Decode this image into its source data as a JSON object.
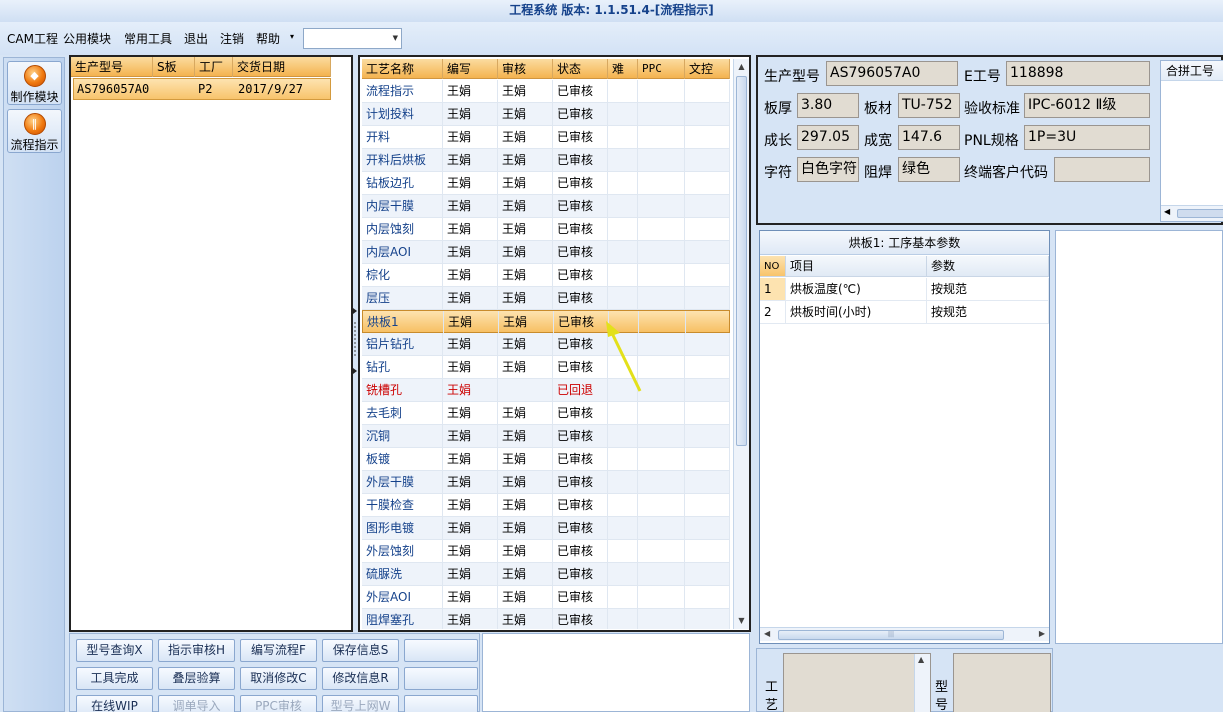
{
  "window": {
    "title": "工程系统 版本: 1.1.51.4-[流程指示]"
  },
  "menu": {
    "items": [
      "CAM工程",
      "公用模块",
      "常用工具",
      "退出",
      "注销",
      "帮助"
    ],
    "dropdown_arrow": "▾",
    "dropdown_value": ""
  },
  "toolbar": {
    "items": [
      {
        "label": "制作模块",
        "icon": "flame-icon"
      },
      {
        "label": "流程指示",
        "icon": "pause-bars-icon"
      }
    ]
  },
  "orders": {
    "columns": [
      "生产型号",
      "S板",
      "工厂",
      "交货日期"
    ],
    "rows": [
      {
        "model": "AS796057A0",
        "s_board": "",
        "factory": "P2",
        "due_date": "2017/9/27"
      }
    ]
  },
  "process": {
    "columns": [
      "工艺名称",
      "编写",
      "审核",
      "状态",
      "难",
      "PPC",
      "文控"
    ],
    "rows": [
      {
        "name": "流程指示",
        "writer": "王娟",
        "reviewer": "王娟",
        "status": "已审核"
      },
      {
        "name": "计划投料",
        "writer": "王娟",
        "reviewer": "王娟",
        "status": "已审核"
      },
      {
        "name": "开料",
        "writer": "王娟",
        "reviewer": "王娟",
        "status": "已审核"
      },
      {
        "name": "开料后烘板",
        "writer": "王娟",
        "reviewer": "王娟",
        "status": "已审核"
      },
      {
        "name": "钻板边孔",
        "writer": "王娟",
        "reviewer": "王娟",
        "status": "已审核"
      },
      {
        "name": "内层干膜",
        "writer": "王娟",
        "reviewer": "王娟",
        "status": "已审核"
      },
      {
        "name": "内层蚀刻",
        "writer": "王娟",
        "reviewer": "王娟",
        "status": "已审核"
      },
      {
        "name": "内层AOI",
        "writer": "王娟",
        "reviewer": "王娟",
        "status": "已审核"
      },
      {
        "name": "棕化",
        "writer": "王娟",
        "reviewer": "王娟",
        "status": "已审核"
      },
      {
        "name": "层压",
        "writer": "王娟",
        "reviewer": "王娟",
        "status": "已审核"
      },
      {
        "name": "烘板1",
        "writer": "王娟",
        "reviewer": "王娟",
        "status": "已审核",
        "selected": true
      },
      {
        "name": "铝片钻孔",
        "writer": "王娟",
        "reviewer": "王娟",
        "status": "已审核"
      },
      {
        "name": "钻孔",
        "writer": "王娟",
        "reviewer": "王娟",
        "status": "已审核"
      },
      {
        "name": "铣槽孔",
        "writer": "王娟",
        "reviewer": "",
        "status": "已回退",
        "returned": true
      },
      {
        "name": "去毛刺",
        "writer": "王娟",
        "reviewer": "王娟",
        "status": "已审核"
      },
      {
        "name": "沉铜",
        "writer": "王娟",
        "reviewer": "王娟",
        "status": "已审核"
      },
      {
        "name": "板镀",
        "writer": "王娟",
        "reviewer": "王娟",
        "status": "已审核"
      },
      {
        "name": "外层干膜",
        "writer": "王娟",
        "reviewer": "王娟",
        "status": "已审核"
      },
      {
        "name": "干膜检查",
        "writer": "王娟",
        "reviewer": "王娟",
        "status": "已审核"
      },
      {
        "name": "图形电镀",
        "writer": "王娟",
        "reviewer": "王娟",
        "status": "已审核"
      },
      {
        "name": "外层蚀刻",
        "writer": "王娟",
        "reviewer": "王娟",
        "status": "已审核"
      },
      {
        "name": "硫脲洗",
        "writer": "王娟",
        "reviewer": "王娟",
        "status": "已审核"
      },
      {
        "name": "外层AOI",
        "writer": "王娟",
        "reviewer": "王娟",
        "status": "已审核"
      },
      {
        "name": "阻焊塞孔",
        "writer": "王娟",
        "reviewer": "王娟",
        "status": "已审核"
      }
    ]
  },
  "info": {
    "model_label": "生产型号",
    "model": "AS796057A0",
    "eno_label": "E工号",
    "eno": "118898",
    "thickness_label": "板厚",
    "thickness": "3.80",
    "material_label": "板材",
    "material": "TU-752",
    "standard_label": "验收标准",
    "standard": "IPC-6012 Ⅱ级",
    "length_label": "成长",
    "length": "297.05",
    "width_label": "成宽",
    "width": "147.6",
    "pnl_label": "PNL规格",
    "pnl": "1P=3U",
    "char_label": "字符",
    "char": "白色字符",
    "mask_label": "阻焊",
    "mask": "绿色",
    "customer_label": "终端客户代码",
    "customer": "",
    "merge_label": "合拼工号"
  },
  "params": {
    "title": "烘板1: 工序基本参数",
    "columns": [
      "NO",
      "项目",
      "参数"
    ],
    "rows": [
      {
        "no": "1",
        "item": "烘板温度(℃)",
        "value": "按规范"
      },
      {
        "no": "2",
        "item": "烘板时间(小时)",
        "value": "按规范"
      }
    ]
  },
  "buttons": {
    "row1": [
      "型号查询X",
      "指示审核H",
      "编写流程F",
      "保存信息S",
      ""
    ],
    "row2": [
      "工具完成",
      "叠层验算",
      "取消修改C",
      "修改信息R",
      ""
    ],
    "row3": [
      "在线WIP",
      "调单导入",
      "PPC审核",
      "型号上网W",
      ""
    ]
  },
  "bottom": {
    "craft_label": "工艺",
    "model_label": "型号"
  },
  "colors": {
    "selection": "#f8c46c",
    "returned": "#cc0000",
    "header": "#f4b350"
  }
}
